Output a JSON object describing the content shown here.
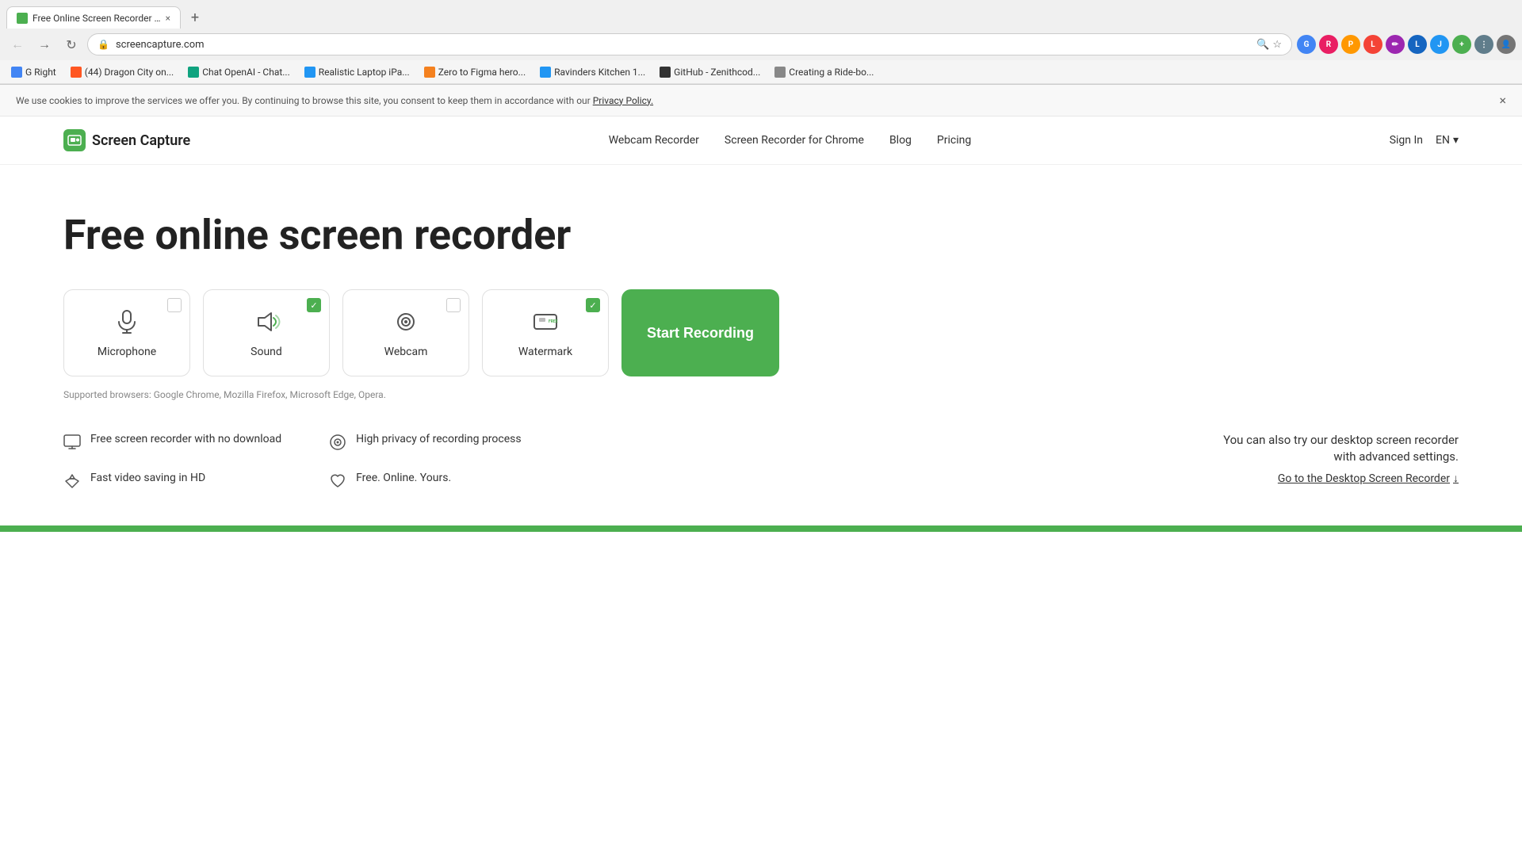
{
  "browser": {
    "tab": {
      "title": "Free Online Screen Recorder | C...",
      "favicon_color": "#4caf50"
    },
    "address": "screencapture.com",
    "bookmarks": [
      {
        "label": "G Right",
        "color": "#4285f4"
      },
      {
        "label": "(44) Dragon City on...",
        "color": "#ff5722"
      },
      {
        "label": "Chat OpenAI - Chat...",
        "color": "#10a37f"
      },
      {
        "label": "Realistic Laptop iPa...",
        "color": "#2196f3"
      },
      {
        "label": "Zero to Figma hero...",
        "color": "#f4811f"
      },
      {
        "label": "Ravinders Kitchen 1...",
        "color": "#2196f3"
      },
      {
        "label": "GitHub - Zenithcod...",
        "color": "#333"
      },
      {
        "label": "Creating a Ride-bo...",
        "color": "#888"
      }
    ]
  },
  "cookie_banner": {
    "text": "We use cookies to improve the services we offer you. By continuing to browse this site, you consent to keep them in accordance with our",
    "link_text": "Privacy Policy.",
    "close_label": "×"
  },
  "nav": {
    "logo_text": "Screen Capture",
    "links": [
      {
        "label": "Webcam Recorder"
      },
      {
        "label": "Screen Recorder for Chrome"
      },
      {
        "label": "Blog"
      },
      {
        "label": "Pricing"
      }
    ],
    "sign_in": "Sign In",
    "lang": "EN"
  },
  "hero": {
    "title": "Free online screen recorder",
    "options": [
      {
        "id": "microphone",
        "label": "Microphone",
        "checked": false
      },
      {
        "id": "sound",
        "label": "Sound",
        "checked": true
      },
      {
        "id": "webcam",
        "label": "Webcam",
        "checked": false
      },
      {
        "id": "watermark",
        "label": "Watermark",
        "checked": true
      }
    ],
    "start_button": "Start Recording",
    "supported_text": "Supported browsers: Google Chrome, Mozilla Firefox, Microsoft Edge, Opera."
  },
  "features": [
    {
      "icon": "monitor",
      "text": "Free screen recorder with no download"
    },
    {
      "icon": "privacy",
      "text": "High privacy of recording process"
    },
    {
      "icon": "diamond",
      "text": "Fast video saving in HD"
    },
    {
      "icon": "heart",
      "text": "Free. Online. Yours."
    }
  ],
  "desktop_cta": {
    "text": "You can also try our desktop screen recorder\nwith advanced settings.",
    "link_text": "Go to the Desktop Screen Recorder",
    "arrow": "↓"
  }
}
